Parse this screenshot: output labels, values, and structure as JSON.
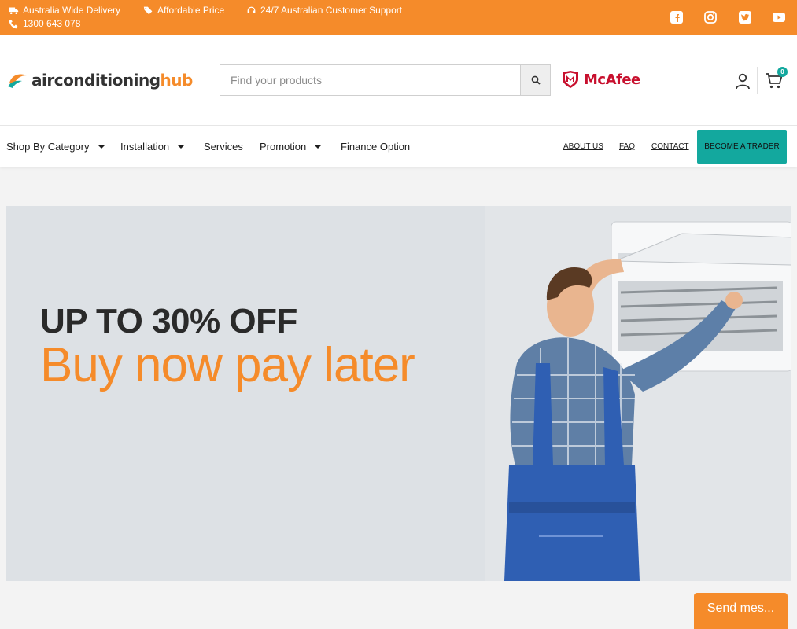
{
  "topbar": {
    "delivery": "Australia Wide Delivery",
    "price": "Affordable Price",
    "support": "24/7 Australian Customer Support",
    "phone": "1300 643 078",
    "socials": [
      "facebook-icon",
      "instagram-icon",
      "twitter-icon",
      "youtube-icon"
    ]
  },
  "brand": {
    "logo_main": "airconditioning",
    "logo_accent": "hub",
    "accent_color": "#f58b2a",
    "teal_color": "#13a89e"
  },
  "search": {
    "placeholder": "Find your products"
  },
  "mcafee": {
    "label": "McAfee"
  },
  "cart": {
    "count": "0"
  },
  "nav": {
    "shop_by_category": "Shop By Category",
    "installation": "Installation",
    "services": "Services",
    "promotion": "Promotion",
    "finance": "Finance Option",
    "about": "ABOUT US",
    "faq": "FAQ",
    "contact": "CONTACT",
    "become_trader": "BECOME A TRADER"
  },
  "hero": {
    "title": "UP TO 30% OFF",
    "subtitle": "Buy now pay later"
  },
  "chat": {
    "send_label": "Send mes..."
  }
}
